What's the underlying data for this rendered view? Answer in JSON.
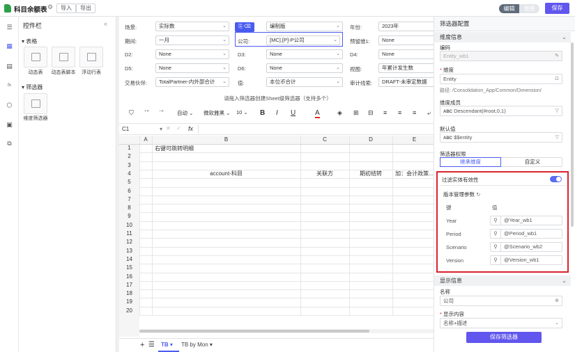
{
  "app": {
    "title": "科目余额表",
    "import_label": "导入",
    "export_label": "导出",
    "mode_edit": "编辑",
    "mode_use": "使用",
    "save_label": "保存"
  },
  "widgets": {
    "title": "控件栏",
    "collapse": "«",
    "section_table": "表格",
    "items_table": [
      "动态表",
      "动态表脚本",
      "浮动行表"
    ],
    "section_filter": "筛选器",
    "items_filter": [
      "维度筛选器"
    ]
  },
  "filters": {
    "scenario": {
      "label": "场景:",
      "value": "实际数"
    },
    "period": {
      "label": "期间:",
      "value": "一月"
    },
    "d2": {
      "label": "D2:",
      "value": "None"
    },
    "d5": {
      "label": "D5:",
      "value": "None"
    },
    "partner": {
      "label": "交易伙伴:",
      "value": "TotalPartner-内外部合计"
    },
    "version": {
      "value": "编制版"
    },
    "company": {
      "label": "公司:",
      "value": "[MC].[P]-P公司"
    },
    "d3": {
      "label": "D3:",
      "value": "None"
    },
    "d6": {
      "label": "D6:",
      "value": "None"
    },
    "value": {
      "label": "值:",
      "value": "本位币合计"
    },
    "year": {
      "label": "年份:",
      "value": "2023年"
    },
    "reserve1": {
      "label": "预留维1:",
      "value": "None"
    },
    "d4": {
      "label": "D4:",
      "value": "None"
    },
    "view": {
      "label": "视图:",
      "value": "年累计发生数"
    },
    "audit": {
      "label": "审计线索:",
      "value": "DRAFT-未审定数据"
    }
  },
  "hint": "请拖入筛选器创建Sheet级筛选器（支持多个）",
  "toolbar": {
    "align": "自动",
    "font": "微软雅黑",
    "size": "10"
  },
  "formula": {
    "cell_ref": "C1",
    "fx": "fx"
  },
  "grid": {
    "columns": [
      "A",
      "B",
      "C",
      "D",
      "E"
    ],
    "rows": [
      "1",
      "2",
      "3",
      "4",
      "5",
      "6",
      "7",
      "8",
      "9",
      "10",
      "11",
      "12",
      "13",
      "14",
      "15",
      "16",
      "17",
      "18",
      "19",
      "20"
    ],
    "b1": "右键可跳转明细",
    "row2": [
      "account-科目",
      "关联方",
      "期初结转",
      "加：会计政策..."
    ]
  },
  "sheets": {
    "active": "TB",
    "other": "TB by Mon"
  },
  "panel": {
    "title": "筛选器配置",
    "sec_dim": "维度信息",
    "code_label": "编码",
    "code_value": "Entity_wb1",
    "dim_label": "维度",
    "dim_value": "Entity",
    "path": "路径: /Consolidation_App/Common/Dimension/",
    "member_label": "维度成员",
    "member_value": "Descendant(#root,0,1)",
    "default_label": "默认值",
    "default_value": "$$entity",
    "perm_label": "筛选器权限",
    "perm_tab1": "继承维度",
    "perm_tab2": "自定义",
    "filter_valid": "过滤实体有效性",
    "version_params": "版本管理参数",
    "key_header": "键",
    "value_header": "值",
    "params": [
      {
        "k": "Year",
        "v": "@Year_wb1"
      },
      {
        "k": "Period",
        "v": "@Period_wb1"
      },
      {
        "k": "Scenario",
        "v": "@Scenario_wb2"
      },
      {
        "k": "Version",
        "v": "@Version_wb1"
      }
    ],
    "sec_display": "显示信息",
    "name_label": "名称",
    "name_value": "公司",
    "content_label": "显示内容",
    "content_value": "名称+描述",
    "save_filter": "保存筛选器"
  }
}
